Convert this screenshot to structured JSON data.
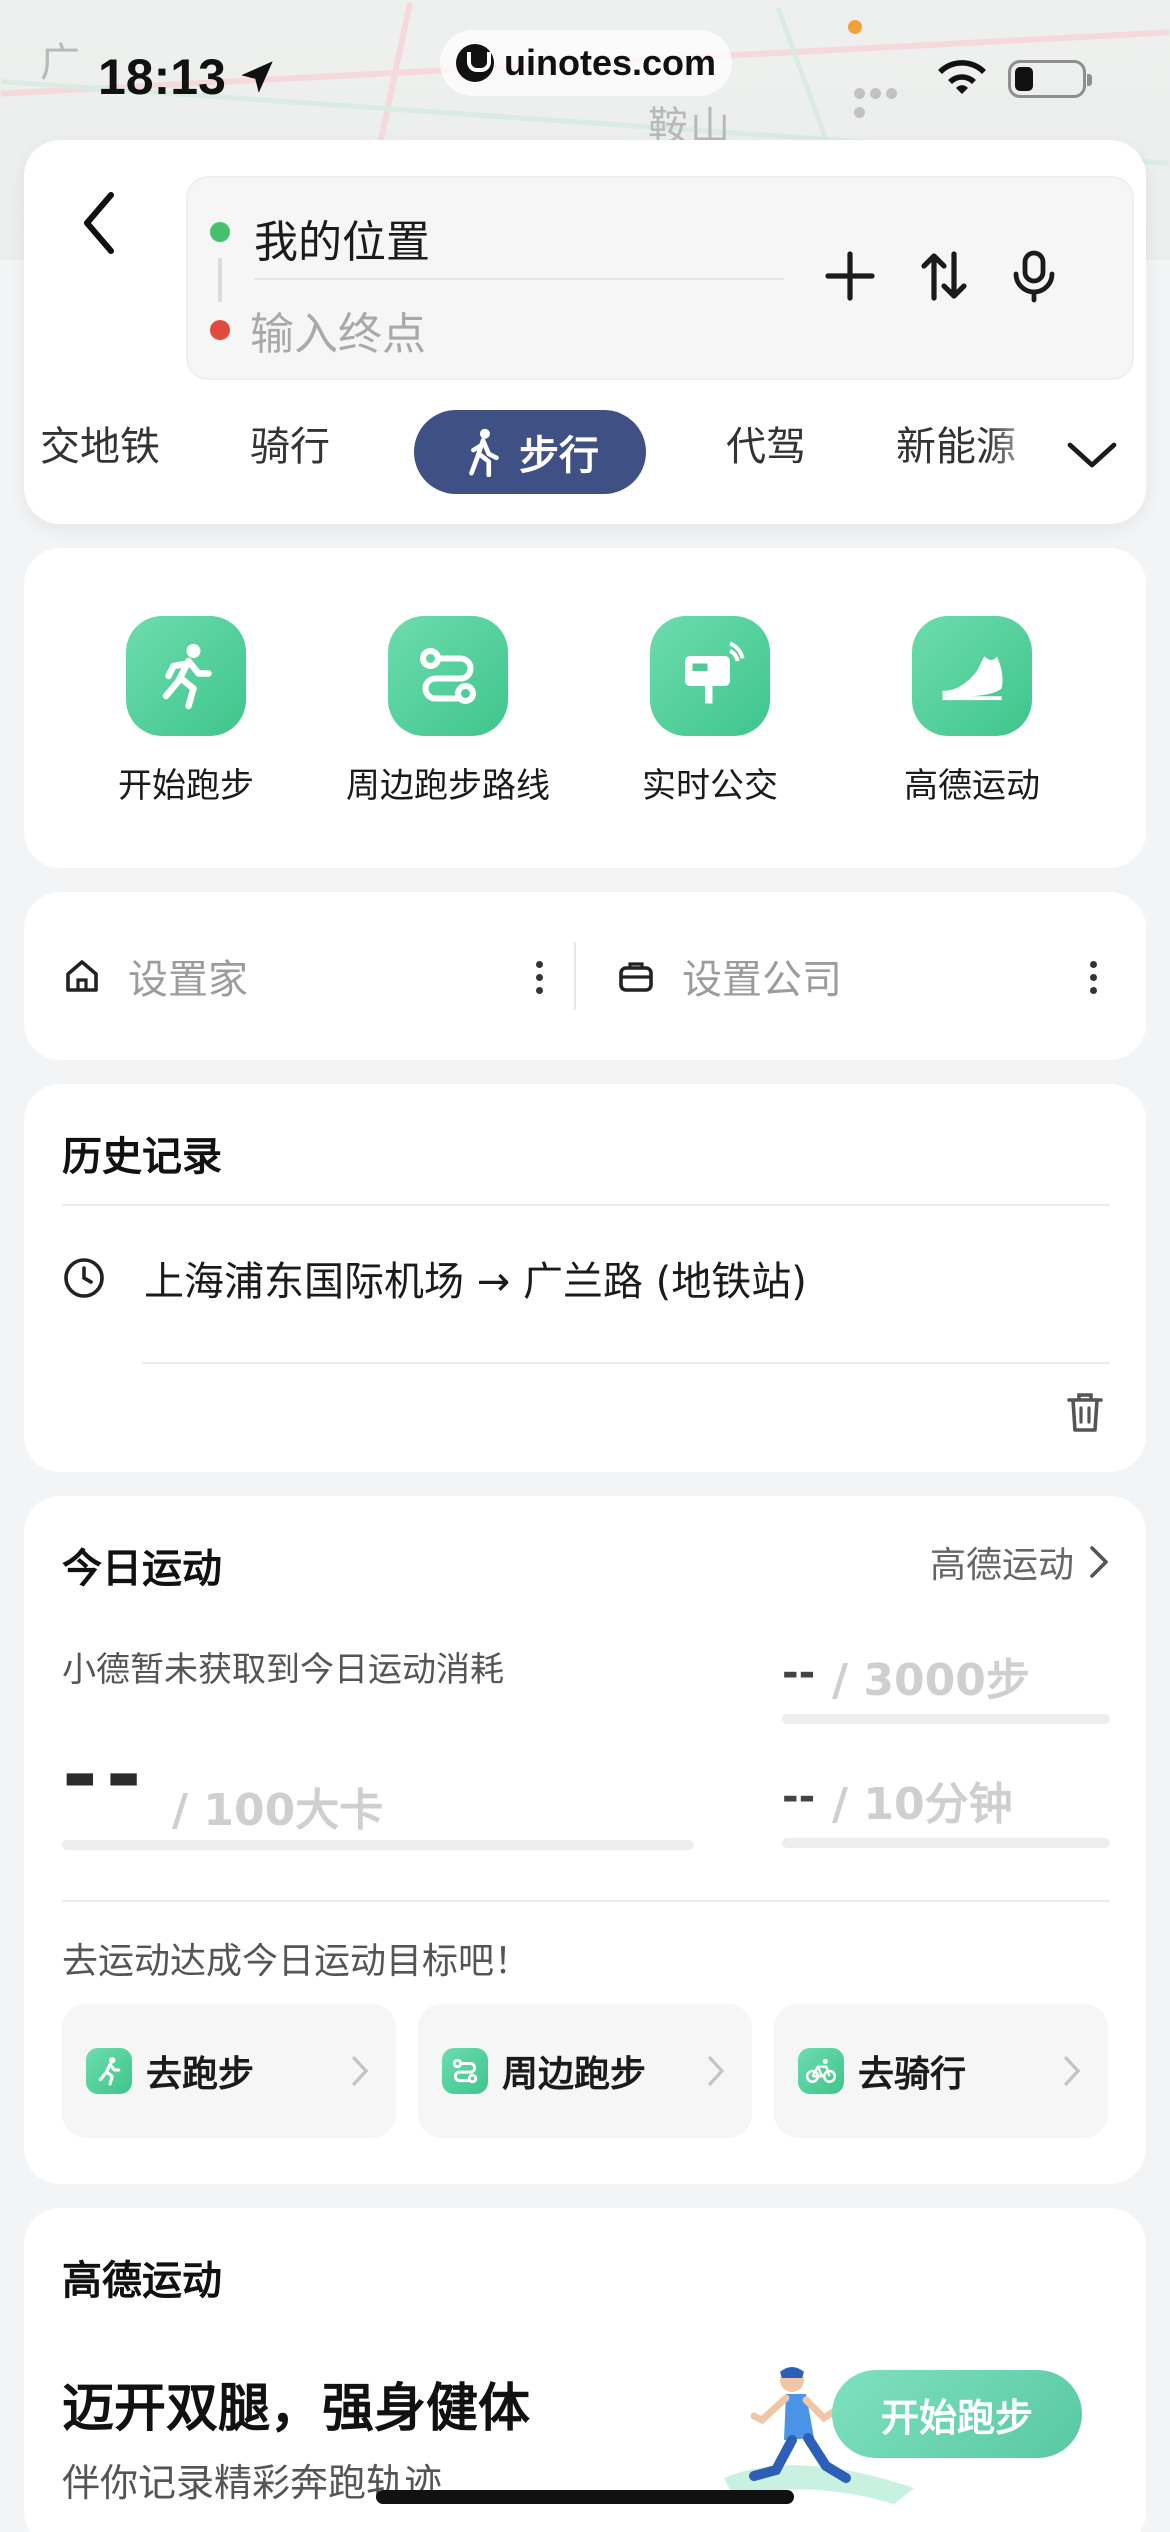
{
  "status_bar": {
    "time": "18:13",
    "url": "uinotes.com"
  },
  "map": {
    "place_1": "广",
    "place_2": "鞍山"
  },
  "route": {
    "from": "我的位置",
    "to_placeholder": "输入终点"
  },
  "modes": {
    "items": [
      "交地铁",
      "骑行",
      "步行",
      "代驾",
      "新能源"
    ],
    "active": "步行"
  },
  "quick_actions": [
    {
      "label": "开始跑步",
      "icon": "running-person-icon"
    },
    {
      "label": "周边跑步路线",
      "icon": "route-icon"
    },
    {
      "label": "实时公交",
      "icon": "bus-stop-icon"
    },
    {
      "label": "高德运动",
      "icon": "sneaker-icon"
    }
  ],
  "places": {
    "home": "设置家",
    "company": "设置公司"
  },
  "history": {
    "title": "历史记录",
    "items": [
      "上海浦东国际机场 → 广兰路 (地铁站)"
    ]
  },
  "today_sport": {
    "title": "今日运动",
    "link": "高德运动",
    "message": "小德暂未获取到今日运动消耗",
    "kcal_value": "--",
    "kcal_goal": "/ 100大卡",
    "steps_value": "--",
    "steps_goal": "/ 3000步",
    "minutes_value": "--",
    "minutes_goal": "/ 10分钟",
    "tip": "去运动达成今日运动目标吧！",
    "actions": [
      "去跑步",
      "周边跑步",
      "去骑行"
    ]
  },
  "gaode_sport": {
    "title": "高德运动",
    "slogan": "迈开双腿，强身健体",
    "subtitle": "伴你记录精彩奔跑轨迹",
    "button": "开始跑步"
  },
  "colors": {
    "accent_green": "#3fc58c",
    "active_tab": "#3f5184",
    "origin_dot": "#46c06d",
    "dest_dot": "#e24a3f"
  }
}
